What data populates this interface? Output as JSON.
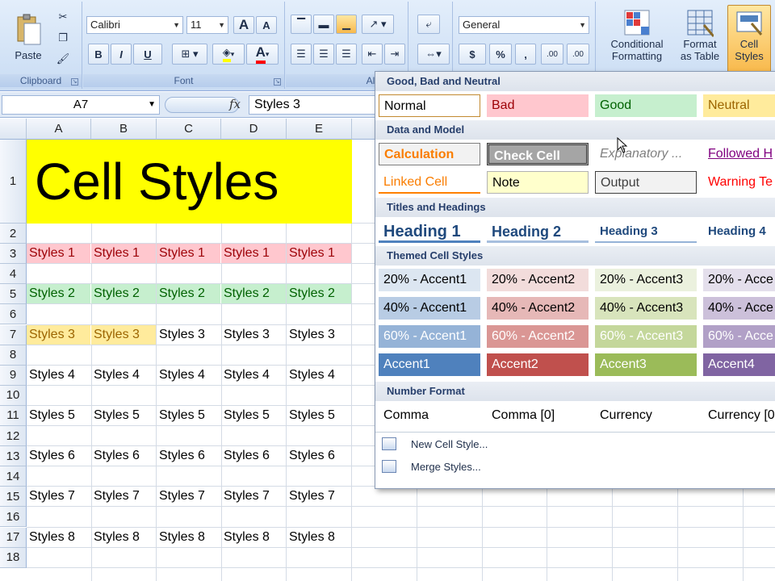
{
  "ribbon": {
    "clipboard": {
      "label": "Clipboard",
      "paste_label": "Paste"
    },
    "font": {
      "label": "Font",
      "font_name": "Calibri",
      "font_size": "11",
      "bold": "B",
      "italic": "I",
      "underline": "U",
      "grow": "A",
      "shrink": "A",
      "font_color_letter": "A"
    },
    "alignment": {
      "label": "Alignme"
    },
    "number": {
      "format": "General",
      "currency": "$",
      "percent": "%",
      "comma": ",",
      "inc_decimal": ".00",
      "dec_decimal": ".00"
    },
    "styles": {
      "conditional_label_1": "Conditional",
      "conditional_label_2": "Formatting",
      "table_label_1": "Format",
      "table_label_2": "as Table",
      "cell_label_1": "Cell",
      "cell_label_2": "Styles"
    }
  },
  "formula_bar": {
    "name_box": "A7",
    "fx": "fx",
    "formula": "Styles 3"
  },
  "grid": {
    "columns": [
      "A",
      "B",
      "C",
      "D",
      "E"
    ],
    "rows": [
      "1",
      "2",
      "3",
      "4",
      "5",
      "6",
      "7",
      "8",
      "9",
      "10",
      "11",
      "12",
      "13",
      "14",
      "15",
      "16",
      "17",
      "18"
    ],
    "title": "Cell Styles",
    "row3": [
      "Styles 1",
      "Styles 1",
      "Styles 1",
      "Styles 1",
      "Styles 1"
    ],
    "row5": [
      "Styles 2",
      "Styles 2",
      "Styles 2",
      "Styles 2",
      "Styles 2"
    ],
    "row7": [
      "Styles 3",
      "Styles 3",
      "Styles 3",
      "Styles 3",
      "Styles 3"
    ],
    "row9": [
      "Styles 4",
      "Styles 4",
      "Styles 4",
      "Styles 4",
      "Styles 4"
    ],
    "row11": [
      "Styles 5",
      "Styles 5",
      "Styles 5",
      "Styles 5",
      "Styles 5"
    ],
    "row13": [
      "Styles 6",
      "Styles 6",
      "Styles 6",
      "Styles 6",
      "Styles 6"
    ],
    "row15": [
      "Styles 7",
      "Styles 7",
      "Styles 7",
      "Styles 7",
      "Styles 7"
    ],
    "row17": [
      "Styles 8",
      "Styles 8",
      "Styles 8",
      "Styles 8",
      "Styles 8"
    ]
  },
  "gallery": {
    "sections": [
      {
        "title": "Good, Bad and Neutral",
        "styles": [
          "Normal",
          "Bad",
          "Good",
          "Neutral"
        ]
      },
      {
        "title": "Data and Model",
        "styles": [
          "Calculation",
          "Check Cell",
          "Explanatory ...",
          "Followed H",
          "Linked Cell",
          "Note",
          "Output",
          "Warning Te"
        ]
      },
      {
        "title": "Titles and Headings",
        "styles": [
          "Heading 1",
          "Heading 2",
          "Heading 3",
          "Heading 4"
        ]
      },
      {
        "title": "Themed Cell Styles",
        "styles": [
          "20% - Accent1",
          "20% - Accent2",
          "20% - Accent3",
          "20% - Acce",
          "40% - Accent1",
          "40% - Accent2",
          "40% - Accent3",
          "40% - Acce",
          "60% - Accent1",
          "60% - Accent2",
          "60% - Accent3",
          "60% - Acce",
          "Accent1",
          "Accent2",
          "Accent3",
          "Accent4"
        ]
      },
      {
        "title": "Number Format",
        "styles": [
          "Comma",
          "Comma [0]",
          "Currency",
          "Currency [0"
        ]
      }
    ],
    "menu": {
      "new_style": "New Cell Style...",
      "merge_styles": "Merge Styles..."
    }
  },
  "colors": {
    "bad_bg": "#ffc7ce",
    "bad_fg": "#9c0006",
    "good_bg": "#c6efce",
    "good_fg": "#006100",
    "neutral_bg": "#ffeb9c",
    "neutral_fg": "#9c6500",
    "title_bg": "#ffff00",
    "accent1": "#4f81bd",
    "accent2": "#c0504d",
    "accent3": "#9bbb59",
    "accent4": "#8064a2"
  }
}
